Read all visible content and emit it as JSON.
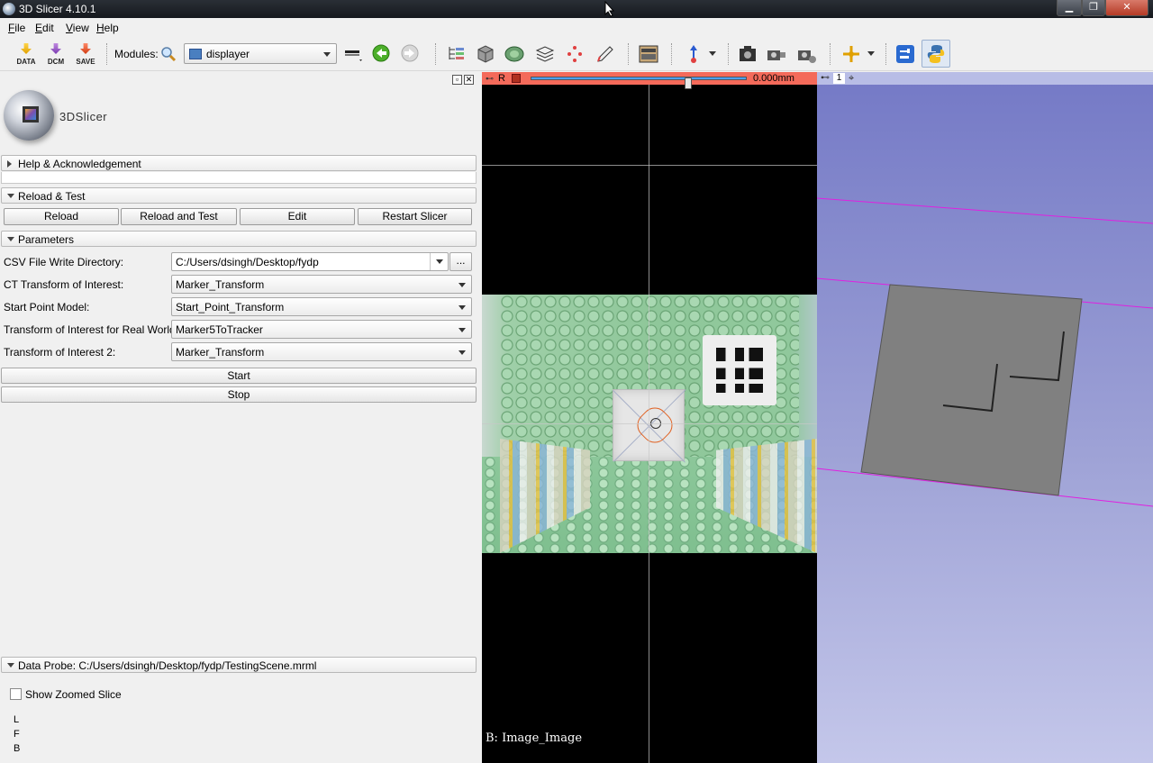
{
  "window": {
    "title": "3D Slicer 4.10.1"
  },
  "menubar": {
    "items": [
      "File",
      "Edit",
      "View",
      "Help"
    ]
  },
  "toolbar": {
    "data_label": "DATA",
    "dcm_label": "DCM",
    "save_label": "SAVE",
    "modules_label": "Modules:",
    "module_selected": "displayer"
  },
  "panel": {
    "logo_text": "3DSlicer",
    "help_section": "Help & Acknowledgement",
    "reload_section": "Reload & Test",
    "reload_buttons": [
      "Reload",
      "Reload and Test",
      "Edit",
      "Restart Slicer"
    ],
    "params_section": "Parameters",
    "fields": [
      {
        "label": "CSV File Write Directory:",
        "value": "C:/Users/dsingh/Desktop/fydp"
      },
      {
        "label": "CT Transform of Interest:",
        "value": "Marker_Transform"
      },
      {
        "label": "Start Point Model:",
        "value": "Start_Point_Transform"
      },
      {
        "label": "Transform of Interest for Real World:",
        "value": "Marker5ToTracker"
      },
      {
        "label": "Transform of Interest 2:",
        "value": "Marker_Transform"
      }
    ],
    "browse_label": "...",
    "start_label": "Start",
    "stop_label": "Stop",
    "data_probe": "Data Probe: C:/Users/dsingh/Desktop/fydp/TestingScene.mrml",
    "show_zoomed_slice": "Show Zoomed Slice",
    "probe_lines": [
      "L",
      "F",
      "B"
    ]
  },
  "slice_view": {
    "orientation": "R",
    "offset": "0.000mm",
    "annotation": "B: Image_Image",
    "bar_color": "#f46a5a"
  },
  "view3d": {
    "number": "1",
    "background_top": "#7479c6",
    "background_bottom": "#c4c7ea",
    "line_color": "#e020e0"
  }
}
